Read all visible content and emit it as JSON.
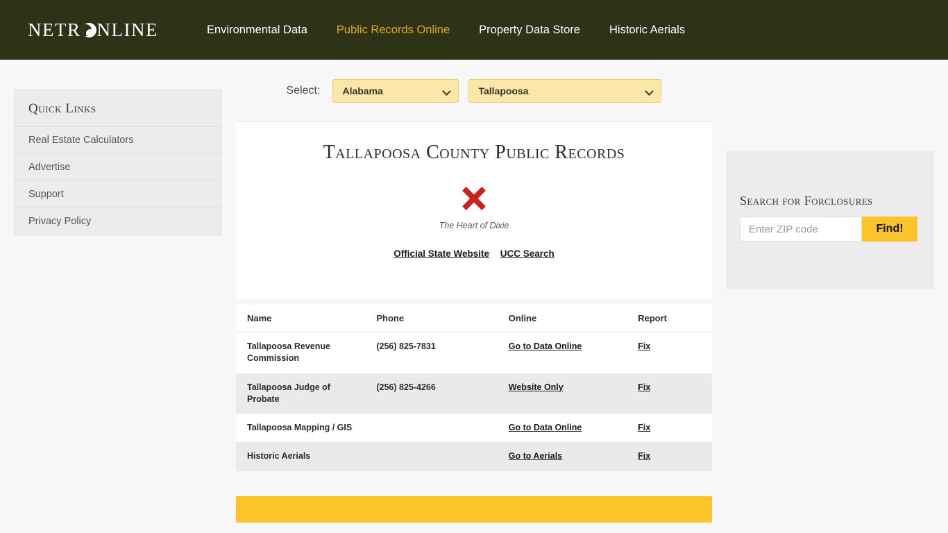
{
  "header": {
    "logo_text_left": "NETR",
    "logo_text_right": "NLINE",
    "logo_icon": "globe-icon",
    "nav": [
      {
        "label": "Environmental Data",
        "active": false
      },
      {
        "label": "Public Records Online",
        "active": true
      },
      {
        "label": "Property Data Store",
        "active": false
      },
      {
        "label": "Historic Aerials",
        "active": false
      }
    ],
    "background_color": "#2e3318",
    "active_color": "#e0a526"
  },
  "quick_links": {
    "title": "Quick Links",
    "items": [
      {
        "label": "Real Estate Calculators"
      },
      {
        "label": "Advertise"
      },
      {
        "label": "Support"
      },
      {
        "label": "Privacy Policy"
      }
    ]
  },
  "selector": {
    "label": "Select:",
    "state_value": "Alabama",
    "county_value": "Tallapoosa",
    "chevron_icon": "chevron-down-icon",
    "background_color": "#fbe7a8"
  },
  "main": {
    "title": "Tallapoosa County Public Records",
    "seal_icon": "broken-image-x-icon",
    "seal_caption": "The Heart of Dixie",
    "links": [
      {
        "label": "Official State Website"
      },
      {
        "label": "UCC Search"
      }
    ]
  },
  "table": {
    "columns": [
      "Name",
      "Phone",
      "Online",
      "Report"
    ],
    "rows": [
      {
        "name": "Tallapoosa Revenue Commission",
        "phone": "(256) 825-7831",
        "online": "Go to Data Online",
        "report": "Fix"
      },
      {
        "name": "Tallapoosa Judge of Probate",
        "phone": "(256) 825-4266",
        "online": "Website Only",
        "report": "Fix"
      },
      {
        "name": "Tallapoosa Mapping / GIS",
        "phone": "",
        "online": "Go to Data Online",
        "report": "Fix"
      },
      {
        "name": "Historic Aerials",
        "phone": "",
        "online": "Go to Aerials",
        "report": "Fix"
      }
    ]
  },
  "foreclosure": {
    "title": "Search for Forclosures",
    "input_placeholder": "Enter ZIP code",
    "input_value": "",
    "button_label": "Find!",
    "button_color": "#fdc42a"
  },
  "footer_banner": {
    "color": "#fdc42a"
  }
}
